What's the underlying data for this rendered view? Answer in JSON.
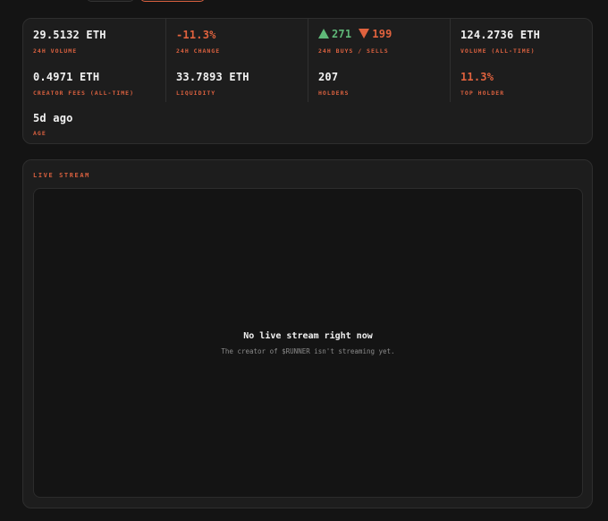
{
  "stats": {
    "volume_24h": {
      "value": "29.5132 ETH",
      "label": "24H VOLUME"
    },
    "change_24h": {
      "value": "-11.3%",
      "label": "24H CHANGE"
    },
    "buys_sells": {
      "buys": "271",
      "sells": "199",
      "label": "24H BUYS / SELLS"
    },
    "volume_all_time": {
      "value": "124.2736 ETH",
      "label": "VOLUME (ALL-TIME)"
    },
    "creator_fees": {
      "value": "0.4971 ETH",
      "label": "CREATOR FEES (ALL-TIME)"
    },
    "liquidity": {
      "value": "33.7893 ETH",
      "label": "LIQUIDITY"
    },
    "holders": {
      "value": "207",
      "label": "HOLDERS"
    },
    "top_holder": {
      "value": "11.3%",
      "label": "TOP HOLDER"
    },
    "age": {
      "value": "5d ago",
      "label": "AGE"
    }
  },
  "live_stream": {
    "title": "LIVE STREAM",
    "empty_title": "No live stream right now",
    "empty_subtitle": "The creator of $RUNNER isn't streaming yet."
  },
  "colors": {
    "accent": "#d9603f",
    "positive": "#5fb878",
    "negative": "#e0623e",
    "panel": "#1d1d1d",
    "background": "#141414"
  },
  "icons": {
    "buys": "triangle-up-icon",
    "sells": "triangle-down-icon"
  }
}
